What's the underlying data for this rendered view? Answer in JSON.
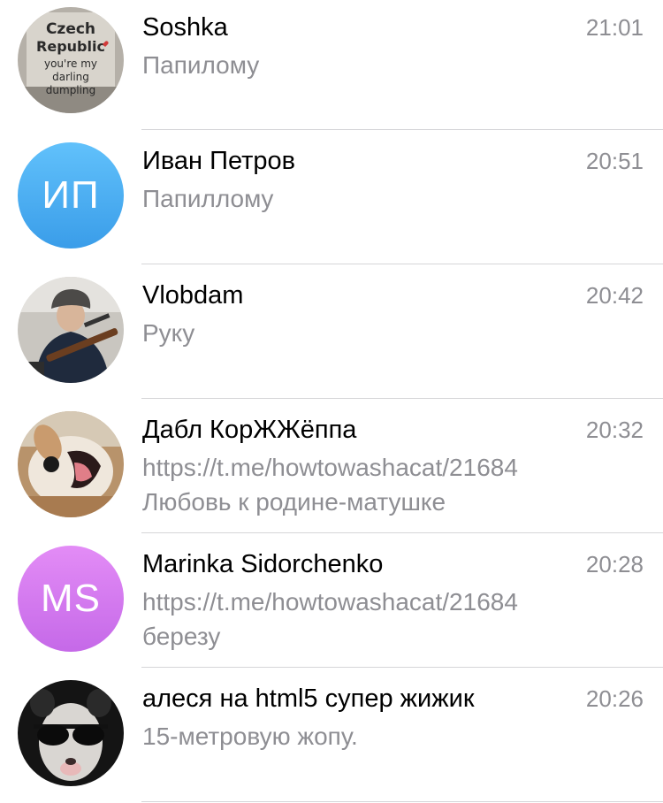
{
  "chats": [
    {
      "name": "Soshka",
      "time": "21:01",
      "message": "Папилому",
      "avatar": {
        "type": "photo",
        "icon": "czech-republic-shirt-photo",
        "photo_text": [
          "Czech",
          "Republic",
          "you're my",
          "darling",
          "dumpling"
        ]
      }
    },
    {
      "name": "Иван Петров",
      "time": "20:51",
      "message": "Папилломy",
      "avatar": {
        "type": "initials",
        "initials": "ИП",
        "color_top": "#61c1fb",
        "color_bottom": "#3a9de9"
      }
    },
    {
      "name": "Vlobdam",
      "time": "20:42",
      "message": "Руку",
      "avatar": {
        "type": "photo",
        "icon": "person-with-rifle-photo"
      }
    },
    {
      "name": "Дабл КорЖЖёппа",
      "time": "20:32",
      "message": "https://t.me/howtowashacat/21684",
      "message2": "Любовь к родине-матушке",
      "avatar": {
        "type": "photo",
        "icon": "dog-photo"
      }
    },
    {
      "name": "Marinka Sidorchenko",
      "time": "20:28",
      "message": "https://t.me/howtowashacat/21684",
      "message2": "березу",
      "avatar": {
        "type": "initials",
        "initials": "MS",
        "color_top": "#e38cf6",
        "color_bottom": "#c569e8"
      }
    },
    {
      "name": "алеся на html5 супер жижик",
      "time": "20:26",
      "message": "15-метровую жопу.",
      "avatar": {
        "type": "photo",
        "icon": "opossum-sunglasses-photo"
      }
    }
  ]
}
